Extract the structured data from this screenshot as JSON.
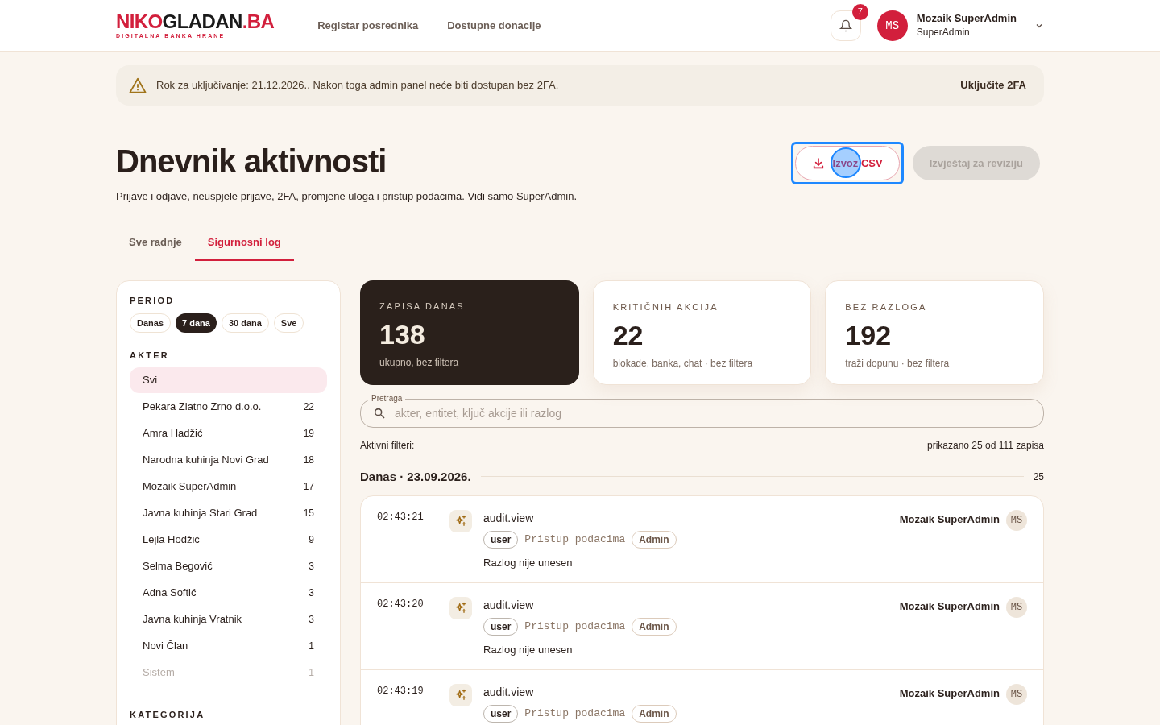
{
  "header": {
    "logo": {
      "part1": "NIKO",
      "part2": "GLADAN",
      "part3": ".BA",
      "tagline": "DIGITALNA BANKA HRANE"
    },
    "nav": [
      "Registar posrednika",
      "Dostupne donacije"
    ],
    "notifications": {
      "count": "7"
    },
    "user": {
      "initials": "MS",
      "name": "Mozaik SuperAdmin",
      "role": "SuperAdmin"
    }
  },
  "banner": {
    "text": "Rok za uključivanje: 21.12.2026.. Nakon toga admin panel neće biti dostupan bez 2FA.",
    "action": "Uključite 2FA"
  },
  "page": {
    "title": "Dnevnik aktivnosti",
    "subtitle": "Prijave i odjave, neuspjele prijave, 2FA, promjene uloga i pristup podacima. Vidi samo SuperAdmin.",
    "actions": [
      {
        "label": "Izvoz CSV",
        "kind": "export",
        "disabled": false,
        "focused": true
      },
      {
        "label": "Izvještaj za reviziju",
        "kind": "plain",
        "disabled": true,
        "focused": false
      }
    ]
  },
  "tabs": [
    {
      "label": "Sve radnje",
      "selected": false
    },
    {
      "label": "Sigurnosni log",
      "selected": true
    }
  ],
  "sidebar": {
    "period": {
      "heading": "PERIOD",
      "options": [
        {
          "label": "Danas",
          "selected": false
        },
        {
          "label": "7 dana",
          "selected": true
        },
        {
          "label": "30 dana",
          "selected": false
        },
        {
          "label": "Sve",
          "selected": false
        }
      ]
    },
    "actors": {
      "heading": "AKTER",
      "items": [
        {
          "name": "Svi",
          "selected": true,
          "disabled": false
        },
        {
          "name": "Pekara Zlatno Zrno d.o.o.",
          "count": "22",
          "selected": false,
          "disabled": false
        },
        {
          "name": "Amra Hadžić",
          "count": "19",
          "selected": false,
          "disabled": false
        },
        {
          "name": "Narodna kuhinja Novi Grad",
          "count": "18",
          "selected": false,
          "disabled": false
        },
        {
          "name": "Mozaik SuperAdmin",
          "count": "17",
          "selected": false,
          "disabled": false
        },
        {
          "name": "Javna kuhinja Stari Grad",
          "count": "15",
          "selected": false,
          "disabled": false
        },
        {
          "name": "Lejla Hodžić",
          "count": "9",
          "selected": false,
          "disabled": false
        },
        {
          "name": "Selma Begović",
          "count": "3",
          "selected": false,
          "disabled": false
        },
        {
          "name": "Adna Softić",
          "count": "3",
          "selected": false,
          "disabled": false
        },
        {
          "name": "Javna kuhinja Vratnik",
          "count": "3",
          "selected": false,
          "disabled": false
        },
        {
          "name": "Novi Član",
          "count": "1",
          "selected": false,
          "disabled": false
        },
        {
          "name": "Sistem",
          "count": "1",
          "selected": false,
          "disabled": true
        }
      ]
    },
    "category": {
      "heading": "KATEGORIJA"
    }
  },
  "stats": [
    {
      "label": "ZAPISA DANAS",
      "value": "138",
      "note": "ukupno, bez filtera",
      "kind": "dark"
    },
    {
      "label": "KRITIČNIH AKCIJA",
      "value": "22",
      "note": "blokade, banka, chat · bez filtera",
      "kind": "light"
    },
    {
      "label": "BEZ RAZLOGA",
      "value": "192",
      "note": "traži dopunu · bez filtera",
      "kind": "light"
    }
  ],
  "search": {
    "label": "Pretraga",
    "placeholder": "akter, entitet, ključ akcije ili razlog"
  },
  "filters": {
    "label": "Aktivni filteri:",
    "summary": "prikazano 25 od 111 zapisa"
  },
  "group": {
    "title": "Danas · 23.09.2026.",
    "count": "25"
  },
  "entries": [
    {
      "time": "02:43:21",
      "action": "audit.view",
      "tags": [
        {
          "text": "user",
          "kind": "pill"
        },
        {
          "text": "Pristup podacima",
          "kind": "mono"
        },
        {
          "text": "Admin",
          "kind": "role"
        }
      ],
      "reason": "Razlog nije unesen",
      "actor": "Mozaik SuperAdmin",
      "initials": "MS"
    },
    {
      "time": "02:43:20",
      "action": "audit.view",
      "tags": [
        {
          "text": "user",
          "kind": "pill"
        },
        {
          "text": "Pristup podacima",
          "kind": "mono"
        },
        {
          "text": "Admin",
          "kind": "role"
        }
      ],
      "reason": "Razlog nije unesen",
      "actor": "Mozaik SuperAdmin",
      "initials": "MS"
    },
    {
      "time": "02:43:19",
      "action": "audit.view",
      "tags": [
        {
          "text": "user",
          "kind": "pill"
        },
        {
          "text": "Pristup podacima",
          "kind": "mono"
        },
        {
          "text": "Admin",
          "kind": "role"
        }
      ],
      "actor": "Mozaik SuperAdmin",
      "initials": "MS"
    }
  ]
}
